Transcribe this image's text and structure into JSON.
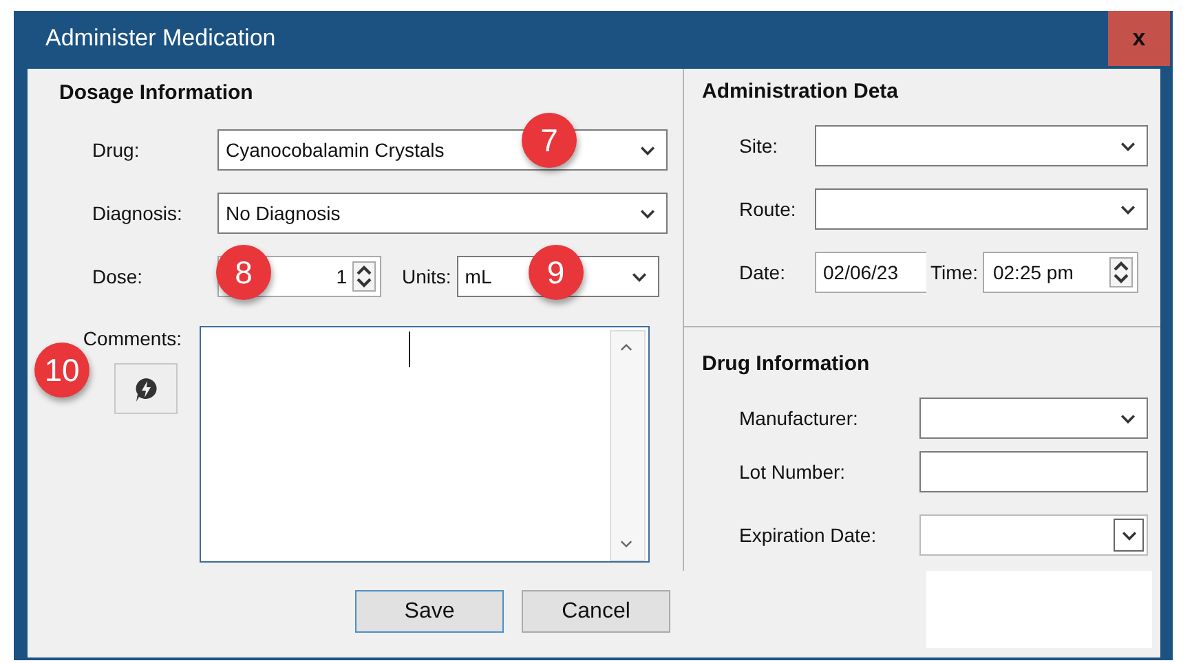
{
  "window": {
    "title": "Administer Medication",
    "close": "x"
  },
  "dosage": {
    "heading": "Dosage Information",
    "fields": [
      {
        "label": "Drug:",
        "value": "Cyanocobalamin Crystals",
        "badge": "7"
      },
      {
        "label": "Diagnosis:",
        "value": "No Diagnosis"
      }
    ],
    "dose": {
      "label": "Dose:",
      "value": "1",
      "badge": "8"
    },
    "units": {
      "label": "Units:",
      "value": "mL",
      "badge": "9"
    },
    "comments": {
      "label": "Comments:",
      "badge": "10"
    }
  },
  "buttons": [
    {
      "label": "Save",
      "focused": true
    },
    {
      "label": "Cancel",
      "focused": false
    }
  ],
  "administration": {
    "heading": "Administration Deta",
    "fields": [
      {
        "label": "Site:"
      },
      {
        "label": "Route:"
      }
    ],
    "date": {
      "label": "Date:",
      "value": "02/06/23"
    },
    "time": {
      "label": "Time:",
      "value": "02:25 pm"
    }
  },
  "drug_information": {
    "heading": "Drug Information",
    "fields": [
      {
        "label": "Manufacturer:",
        "kind": "dropdown"
      },
      {
        "label": "Lot Number:",
        "kind": "text"
      },
      {
        "label": "Expiration Date:",
        "kind": "date"
      }
    ]
  }
}
